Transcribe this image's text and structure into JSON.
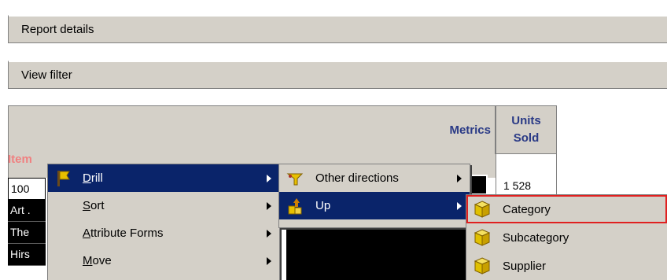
{
  "panels": {
    "report_details": "Report details",
    "view_filter": "View filter"
  },
  "grid": {
    "metrics_header": "Metrics",
    "units_header_line1": "Units",
    "units_header_line2": "Sold",
    "item_header": "Item",
    "first_value": "1 528",
    "row_labels": [
      "100",
      "Art .",
      "The",
      "Hirs"
    ]
  },
  "menu_main": {
    "items": [
      {
        "label": "Drill",
        "mnemonic": "D",
        "rest": "rill",
        "icon": "drill-icon"
      },
      {
        "label": "Sort",
        "mnemonic": "S",
        "rest": "ort"
      },
      {
        "label": "Attribute Forms",
        "mnemonic": "A",
        "rest": "ttribute Forms"
      },
      {
        "label": "Move",
        "mnemonic": "M",
        "rest": "ove"
      }
    ]
  },
  "menu_drill": {
    "items": [
      {
        "label": "Other directions",
        "icon": "other-directions-icon"
      },
      {
        "label": "Up",
        "icon": "drill-up-icon"
      }
    ]
  },
  "menu_up": {
    "items": [
      {
        "label": "Category",
        "icon": "attribute-cube-icon"
      },
      {
        "label": "Subcategory",
        "icon": "attribute-cube-icon"
      },
      {
        "label": "Supplier",
        "icon": "attribute-cube-icon"
      }
    ]
  },
  "colors": {
    "selection": "#0a246a",
    "highlight_border": "#e02020",
    "header_text": "#2a3a86",
    "item_header": "#f08080"
  }
}
